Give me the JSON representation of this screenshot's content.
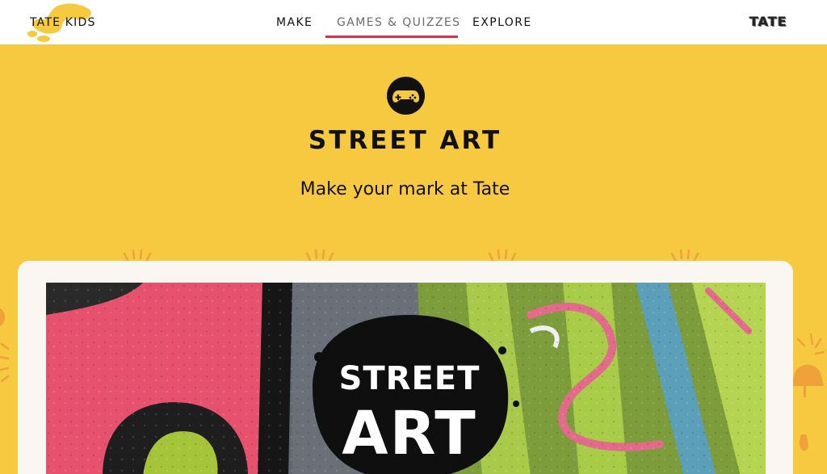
{
  "nav": {
    "logo_text": "TATE KIDS",
    "links": [
      {
        "label": "MAKE",
        "active": false
      },
      {
        "label": "GAMES & QUIZZES",
        "active": true
      },
      {
        "label": "EXPLORE",
        "active": false
      }
    ],
    "right_logo": "TATE"
  },
  "hero": {
    "icon": "gamepad-icon",
    "title": "STREET ART",
    "subtitle": "Make your mark at Tate"
  },
  "card": {
    "image_title_line1": "STREET",
    "image_title_line2": "ART"
  },
  "colors": {
    "background": "#f6c940",
    "nav_underline": "#d9324a",
    "card": "#faf6f1",
    "burst": "#f0a23a"
  }
}
